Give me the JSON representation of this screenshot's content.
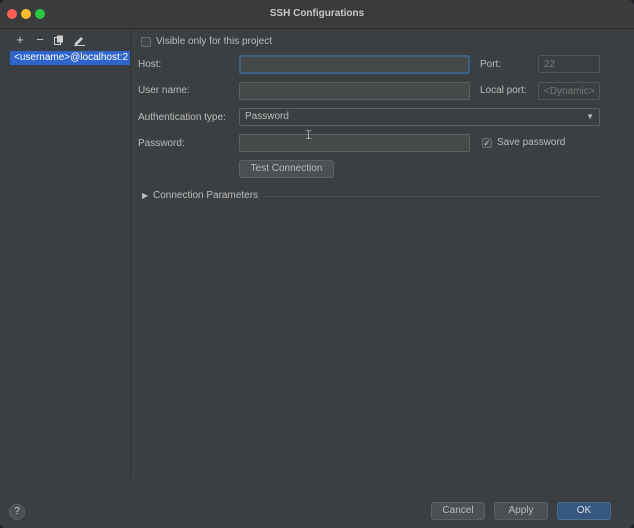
{
  "window": {
    "title": "SSH Configurations"
  },
  "sidebar": {
    "toolbar": {
      "add_icon": "plus-icon",
      "remove_icon": "minus-icon",
      "copy_icon": "copy-icon",
      "edit_icon": "edit-icon"
    },
    "items": [
      {
        "label": "<username>@localhost:2",
        "selected": true
      }
    ]
  },
  "form": {
    "visible_only_label": "Visible only for this project",
    "visible_only_checked": false,
    "host_label": "Host:",
    "host_value": "",
    "port_label": "Port:",
    "port_placeholder": "22",
    "username_label": "User name:",
    "username_value": "",
    "local_port_label": "Local port:",
    "local_port_placeholder": "<Dynamic>",
    "auth_type_label": "Authentication type:",
    "auth_type_value": "Password",
    "password_label": "Password:",
    "password_value": "",
    "save_password_label": "Save password",
    "save_password_checked": true,
    "test_connection_label": "Test Connection",
    "connection_params_label": "Connection Parameters"
  },
  "footer": {
    "help_label": "?",
    "cancel_label": "Cancel",
    "apply_label": "Apply",
    "ok_label": "OK"
  },
  "colors": {
    "background": "#3c3f41",
    "selection": "#2f65ca",
    "primary_button": "#365880",
    "focus_border": "#3d6185"
  }
}
